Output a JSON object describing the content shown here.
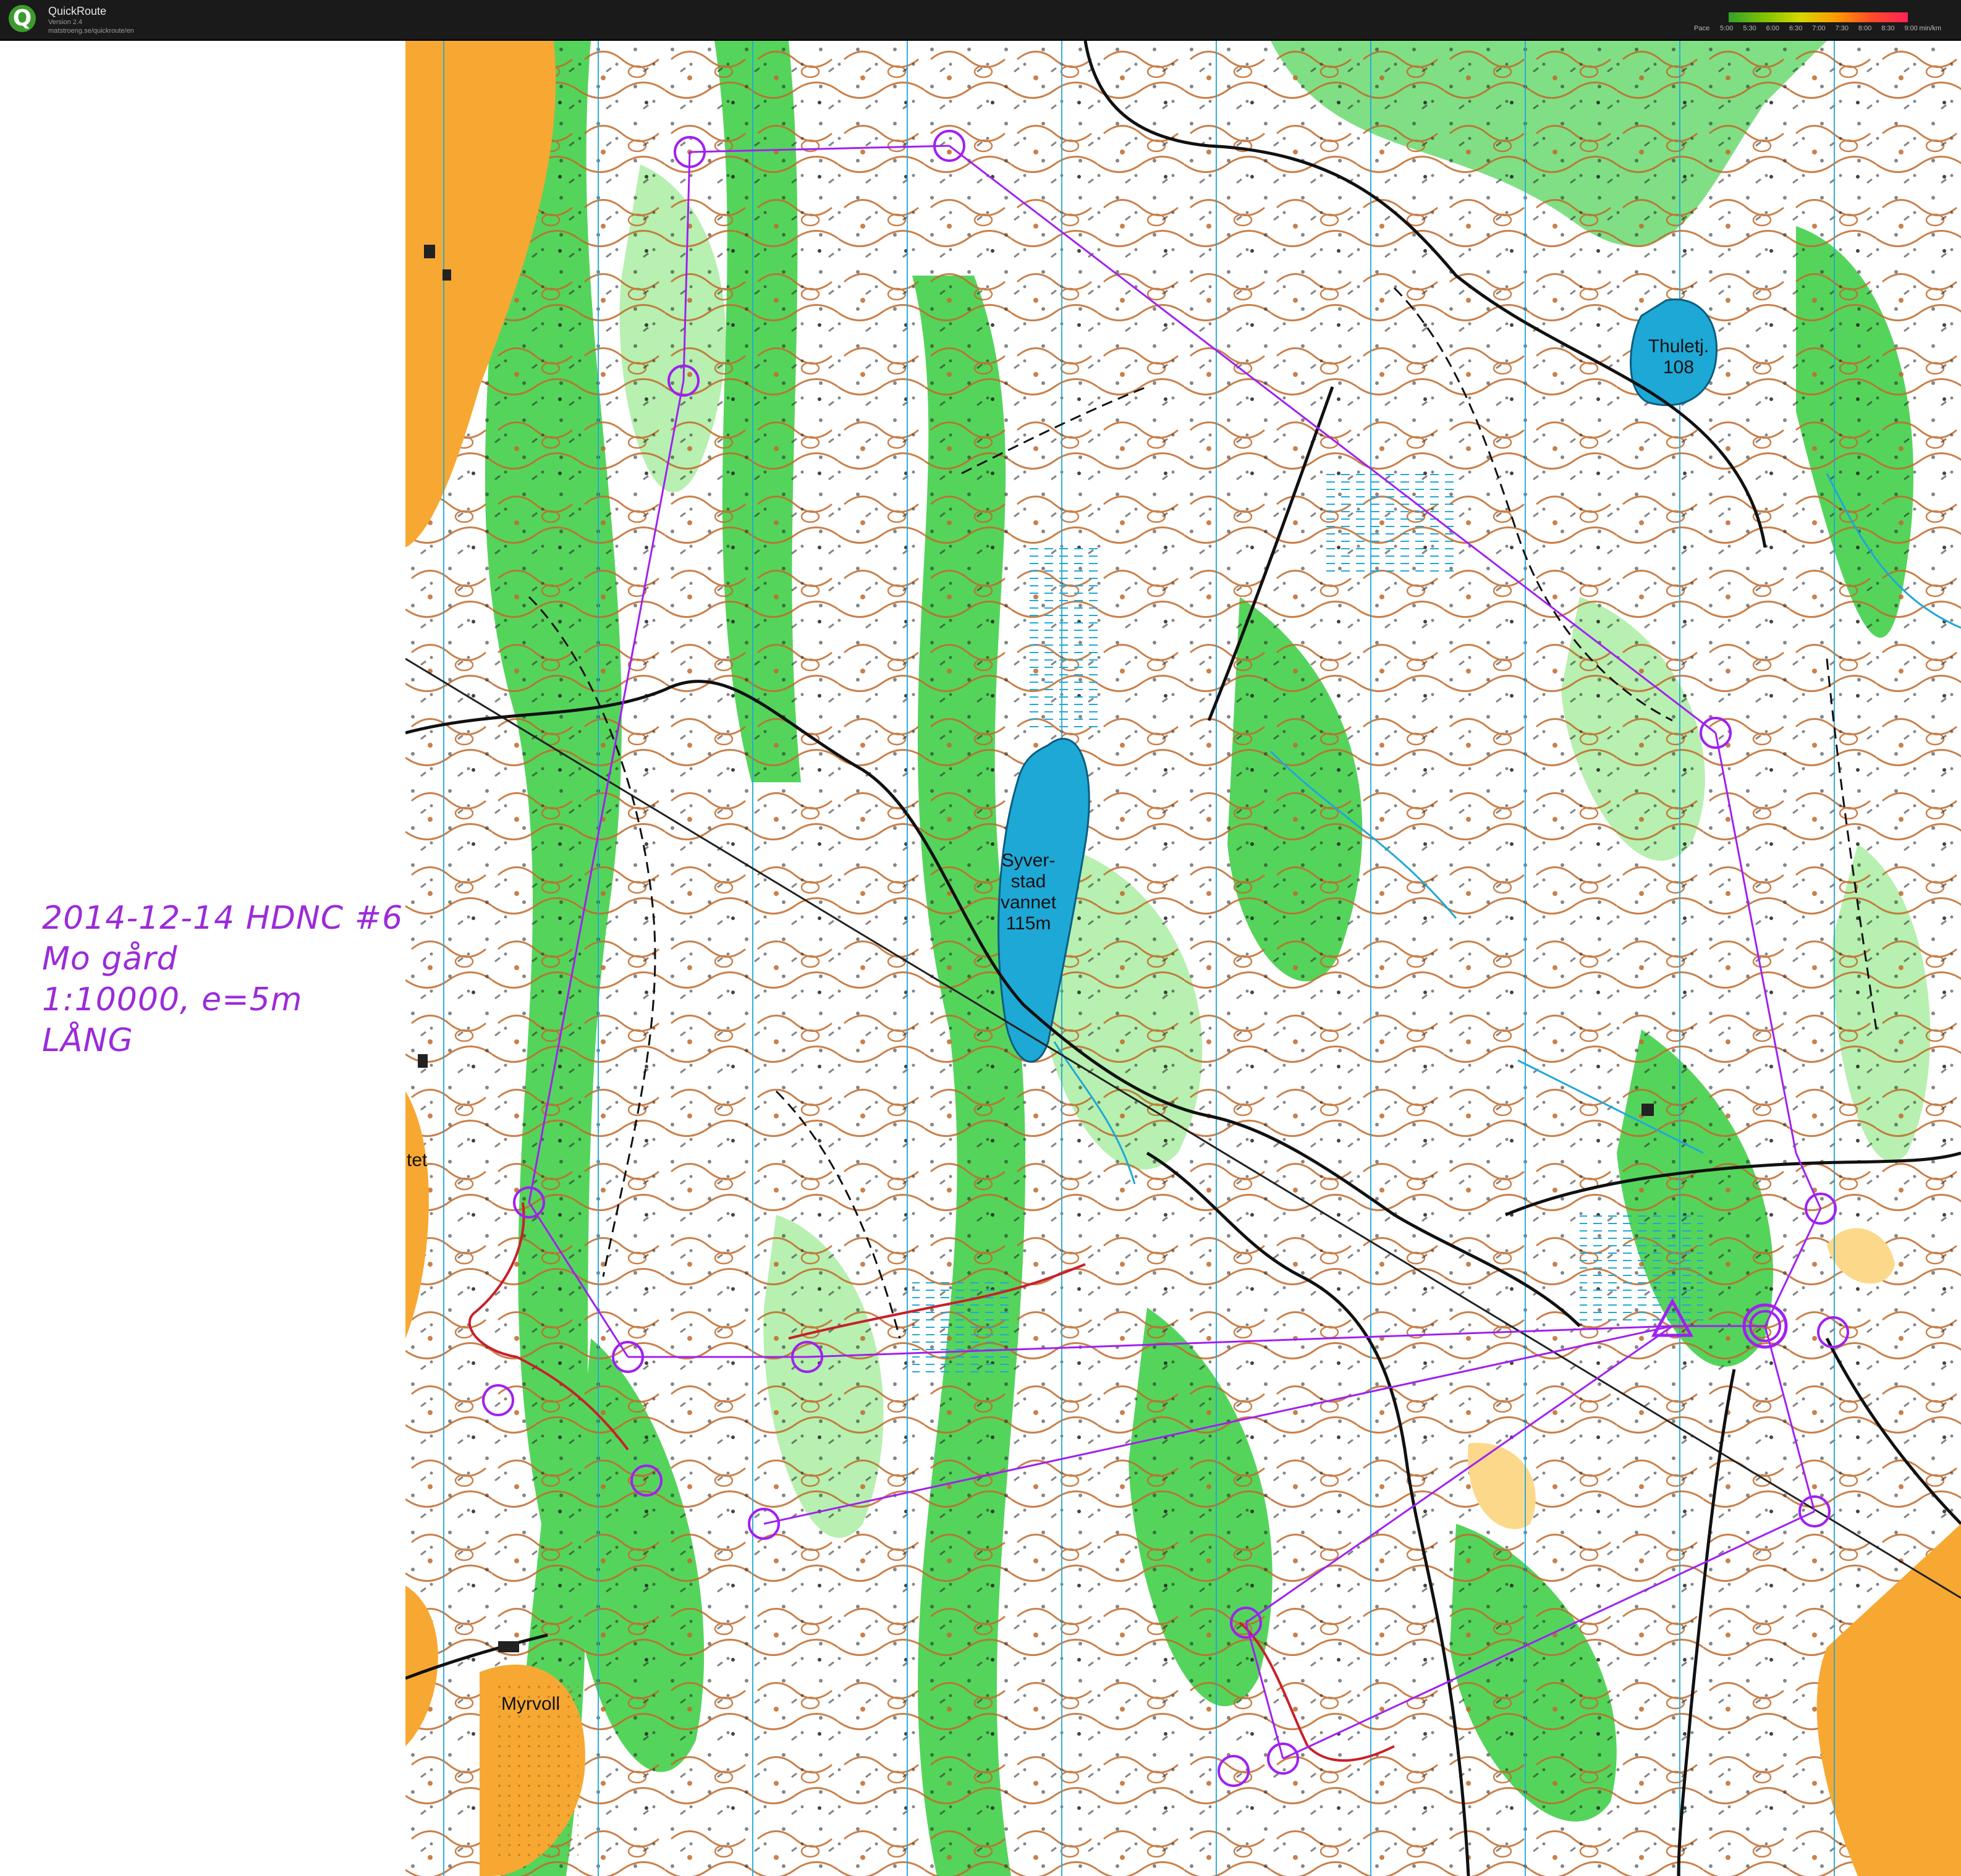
{
  "app": {
    "title": "QuickRoute",
    "version": "Version 2.4",
    "url": "matstroeng.se/quickroute/en",
    "logo_letter": "Q"
  },
  "pace_legend": {
    "label": "Pace",
    "ticks": [
      "5:00",
      "5:30",
      "6:00",
      "6:30",
      "7:00",
      "7:30",
      "8:00",
      "8:30",
      "9:00"
    ],
    "unit": "min/km"
  },
  "caption": {
    "line1": "2014-12-14 HDNC #6",
    "line2": "Mo gård",
    "line3": "1:10000, e=5m",
    "line4": "LÅNG"
  },
  "map_labels": {
    "lake1": [
      "Syver-",
      "stad",
      "vannet",
      "115m"
    ],
    "lake2": [
      "Thuletj.",
      "108"
    ],
    "place1": "Myrvoll",
    "place2": "tet"
  },
  "colors": {
    "forest_white": "#ffffff",
    "green": "#55d45c",
    "light_green": "#b7f0b0",
    "open_yellow": "#f7a832",
    "contour_brown": "#c06a2a",
    "water_blue": "#1ea8d6",
    "course_purple": "#a020f0",
    "route_red": "#c8202a",
    "path_black": "#111111"
  }
}
